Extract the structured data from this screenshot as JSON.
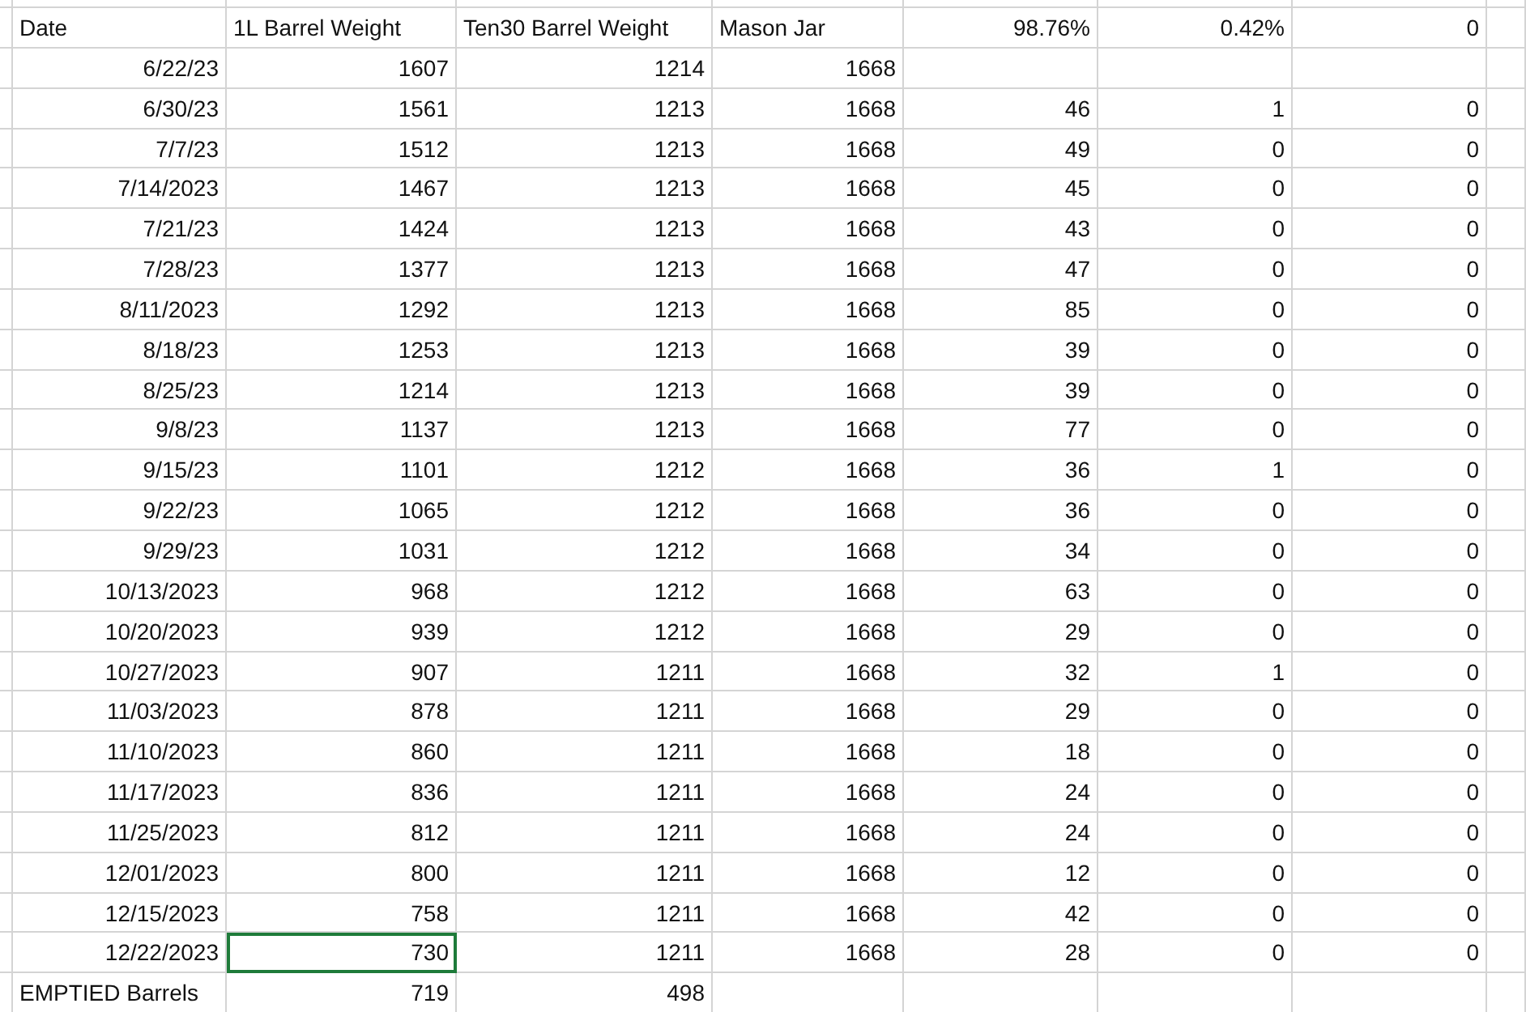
{
  "rows": [
    {
      "kind": "header",
      "cells": [
        {
          "text": "Date",
          "selected": false
        },
        {
          "text": "1L Barrel Weight",
          "selected": false
        },
        {
          "text": "Ten30 Barrel Weight",
          "selected": false
        },
        {
          "text": "Mason Jar",
          "selected": false
        },
        {
          "text": "98.76%",
          "selected": false
        },
        {
          "text": "0.42%",
          "selected": false
        },
        {
          "text": "0",
          "selected": false
        }
      ]
    },
    {
      "kind": "data",
      "cells": [
        {
          "text": "6/22/23",
          "selected": false
        },
        {
          "text": "1607",
          "selected": false
        },
        {
          "text": "1214",
          "selected": false
        },
        {
          "text": "1668",
          "selected": false
        },
        {
          "selected": false
        },
        {
          "selected": false
        },
        {
          "selected": false
        }
      ]
    },
    {
      "kind": "data",
      "cells": [
        {
          "text": "6/30/23",
          "selected": false
        },
        {
          "text": "1561",
          "selected": false
        },
        {
          "text": "1213",
          "selected": false
        },
        {
          "text": "1668",
          "selected": false
        },
        {
          "text": "46",
          "selected": false
        },
        {
          "text": "1",
          "selected": false
        },
        {
          "text": "0",
          "selected": false
        }
      ]
    },
    {
      "kind": "data",
      "cells": [
        {
          "text": "7/7/23",
          "selected": false
        },
        {
          "text": "1512",
          "selected": false
        },
        {
          "text": "1213",
          "selected": false
        },
        {
          "text": "1668",
          "selected": false
        },
        {
          "text": "49",
          "selected": false
        },
        {
          "text": "0",
          "selected": false
        },
        {
          "text": "0",
          "selected": false
        }
      ]
    },
    {
      "kind": "data",
      "cells": [
        {
          "text": "7/14/2023",
          "selected": false
        },
        {
          "text": "1467",
          "selected": false
        },
        {
          "text": "1213",
          "selected": false
        },
        {
          "text": "1668",
          "selected": false
        },
        {
          "text": "45",
          "selected": false
        },
        {
          "text": "0",
          "selected": false
        },
        {
          "text": "0",
          "selected": false
        }
      ]
    },
    {
      "kind": "data",
      "cells": [
        {
          "text": "7/21/23",
          "selected": false
        },
        {
          "text": "1424",
          "selected": false
        },
        {
          "text": "1213",
          "selected": false
        },
        {
          "text": "1668",
          "selected": false
        },
        {
          "text": "43",
          "selected": false
        },
        {
          "text": "0",
          "selected": false
        },
        {
          "text": "0",
          "selected": false
        }
      ]
    },
    {
      "kind": "data",
      "cells": [
        {
          "text": "7/28/23",
          "selected": false
        },
        {
          "text": "1377",
          "selected": false
        },
        {
          "text": "1213",
          "selected": false
        },
        {
          "text": "1668",
          "selected": false
        },
        {
          "text": "47",
          "selected": false
        },
        {
          "text": "0",
          "selected": false
        },
        {
          "text": "0",
          "selected": false
        }
      ]
    },
    {
      "kind": "data",
      "cells": [
        {
          "text": "8/11/2023",
          "selected": false
        },
        {
          "text": "1292",
          "selected": false
        },
        {
          "text": "1213",
          "selected": false
        },
        {
          "text": "1668",
          "selected": false
        },
        {
          "text": "85",
          "selected": false
        },
        {
          "text": "0",
          "selected": false
        },
        {
          "text": "0",
          "selected": false
        }
      ]
    },
    {
      "kind": "data",
      "cells": [
        {
          "text": "8/18/23",
          "selected": false
        },
        {
          "text": "1253",
          "selected": false
        },
        {
          "text": "1213",
          "selected": false
        },
        {
          "text": "1668",
          "selected": false
        },
        {
          "text": "39",
          "selected": false
        },
        {
          "text": "0",
          "selected": false
        },
        {
          "text": "0",
          "selected": false
        }
      ]
    },
    {
      "kind": "data",
      "cells": [
        {
          "text": "8/25/23",
          "selected": false
        },
        {
          "text": "1214",
          "selected": false
        },
        {
          "text": "1213",
          "selected": false
        },
        {
          "text": "1668",
          "selected": false
        },
        {
          "text": "39",
          "selected": false
        },
        {
          "text": "0",
          "selected": false
        },
        {
          "text": "0",
          "selected": false
        }
      ]
    },
    {
      "kind": "data",
      "cells": [
        {
          "text": "9/8/23",
          "selected": false
        },
        {
          "text": "1137",
          "selected": false
        },
        {
          "text": "1213",
          "selected": false
        },
        {
          "text": "1668",
          "selected": false
        },
        {
          "text": "77",
          "selected": false
        },
        {
          "text": "0",
          "selected": false
        },
        {
          "text": "0",
          "selected": false
        }
      ]
    },
    {
      "kind": "data",
      "cells": [
        {
          "text": "9/15/23",
          "selected": false
        },
        {
          "text": "1101",
          "selected": false
        },
        {
          "text": "1212",
          "selected": false
        },
        {
          "text": "1668",
          "selected": false
        },
        {
          "text": "36",
          "selected": false
        },
        {
          "text": "1",
          "selected": false
        },
        {
          "text": "0",
          "selected": false
        }
      ]
    },
    {
      "kind": "data",
      "cells": [
        {
          "text": "9/22/23",
          "selected": false
        },
        {
          "text": "1065",
          "selected": false
        },
        {
          "text": "1212",
          "selected": false
        },
        {
          "text": "1668",
          "selected": false
        },
        {
          "text": "36",
          "selected": false
        },
        {
          "text": "0",
          "selected": false
        },
        {
          "text": "0",
          "selected": false
        }
      ]
    },
    {
      "kind": "data",
      "cells": [
        {
          "text": "9/29/23",
          "selected": false
        },
        {
          "text": "1031",
          "selected": false
        },
        {
          "text": "1212",
          "selected": false
        },
        {
          "text": "1668",
          "selected": false
        },
        {
          "text": "34",
          "selected": false
        },
        {
          "text": "0",
          "selected": false
        },
        {
          "text": "0",
          "selected": false
        }
      ]
    },
    {
      "kind": "data",
      "cells": [
        {
          "text": "10/13/2023",
          "selected": false
        },
        {
          "text": "968",
          "selected": false
        },
        {
          "text": "1212",
          "selected": false
        },
        {
          "text": "1668",
          "selected": false
        },
        {
          "text": "63",
          "selected": false
        },
        {
          "text": "0",
          "selected": false
        },
        {
          "text": "0",
          "selected": false
        }
      ]
    },
    {
      "kind": "data",
      "cells": [
        {
          "text": "10/20/2023",
          "selected": false
        },
        {
          "text": "939",
          "selected": false
        },
        {
          "text": "1212",
          "selected": false
        },
        {
          "text": "1668",
          "selected": false
        },
        {
          "text": "29",
          "selected": false
        },
        {
          "text": "0",
          "selected": false
        },
        {
          "text": "0",
          "selected": false
        }
      ]
    },
    {
      "kind": "data",
      "cells": [
        {
          "text": "10/27/2023",
          "selected": false
        },
        {
          "text": "907",
          "selected": false
        },
        {
          "text": "1211",
          "selected": false
        },
        {
          "text": "1668",
          "selected": false
        },
        {
          "text": "32",
          "selected": false
        },
        {
          "text": "1",
          "selected": false
        },
        {
          "text": "0",
          "selected": false
        }
      ]
    },
    {
      "kind": "data",
      "cells": [
        {
          "text": "11/03/2023",
          "selected": false
        },
        {
          "text": "878",
          "selected": false
        },
        {
          "text": "1211",
          "selected": false
        },
        {
          "text": "1668",
          "selected": false
        },
        {
          "text": "29",
          "selected": false
        },
        {
          "text": "0",
          "selected": false
        },
        {
          "text": "0",
          "selected": false
        }
      ]
    },
    {
      "kind": "data",
      "cells": [
        {
          "text": "11/10/2023",
          "selected": false
        },
        {
          "text": "860",
          "selected": false
        },
        {
          "text": "1211",
          "selected": false
        },
        {
          "text": "1668",
          "selected": false
        },
        {
          "text": "18",
          "selected": false
        },
        {
          "text": "0",
          "selected": false
        },
        {
          "text": "0",
          "selected": false
        }
      ]
    },
    {
      "kind": "data",
      "cells": [
        {
          "text": "11/17/2023",
          "selected": false
        },
        {
          "text": "836",
          "selected": false
        },
        {
          "text": "1211",
          "selected": false
        },
        {
          "text": "1668",
          "selected": false
        },
        {
          "text": "24",
          "selected": false
        },
        {
          "text": "0",
          "selected": false
        },
        {
          "text": "0",
          "selected": false
        }
      ]
    },
    {
      "kind": "data",
      "cells": [
        {
          "text": "11/25/2023",
          "selected": false
        },
        {
          "text": "812",
          "selected": false
        },
        {
          "text": "1211",
          "selected": false
        },
        {
          "text": "1668",
          "selected": false
        },
        {
          "text": "24",
          "selected": false
        },
        {
          "text": "0",
          "selected": false
        },
        {
          "text": "0",
          "selected": false
        }
      ]
    },
    {
      "kind": "data",
      "cells": [
        {
          "text": "12/01/2023",
          "selected": false
        },
        {
          "text": "800",
          "selected": false
        },
        {
          "text": "1211",
          "selected": false
        },
        {
          "text": "1668",
          "selected": false
        },
        {
          "text": "12",
          "selected": false
        },
        {
          "text": "0",
          "selected": false
        },
        {
          "text": "0",
          "selected": false
        }
      ]
    },
    {
      "kind": "data",
      "cells": [
        {
          "text": "12/15/2023",
          "selected": false
        },
        {
          "text": "758",
          "selected": false
        },
        {
          "text": "1211",
          "selected": false
        },
        {
          "text": "1668",
          "selected": false
        },
        {
          "text": "42",
          "selected": false
        },
        {
          "text": "0",
          "selected": false
        },
        {
          "text": "0",
          "selected": false
        }
      ]
    },
    {
      "kind": "data",
      "cells": [
        {
          "text": "12/22/2023",
          "selected": false
        },
        {
          "text": "730",
          "selected": true
        },
        {
          "text": "1211",
          "selected": false
        },
        {
          "text": "1668",
          "selected": false
        },
        {
          "text": "28",
          "selected": false
        },
        {
          "text": "0",
          "selected": false
        },
        {
          "text": "0",
          "selected": false
        }
      ]
    },
    {
      "kind": "total",
      "cells": [
        {
          "text": "EMPTIED Barrels",
          "selected": false
        },
        {
          "text": "719",
          "selected": false
        },
        {
          "text": "498",
          "selected": false
        },
        {
          "selected": false
        },
        {
          "selected": false
        },
        {
          "selected": false
        },
        {
          "selected": false
        }
      ]
    }
  ]
}
